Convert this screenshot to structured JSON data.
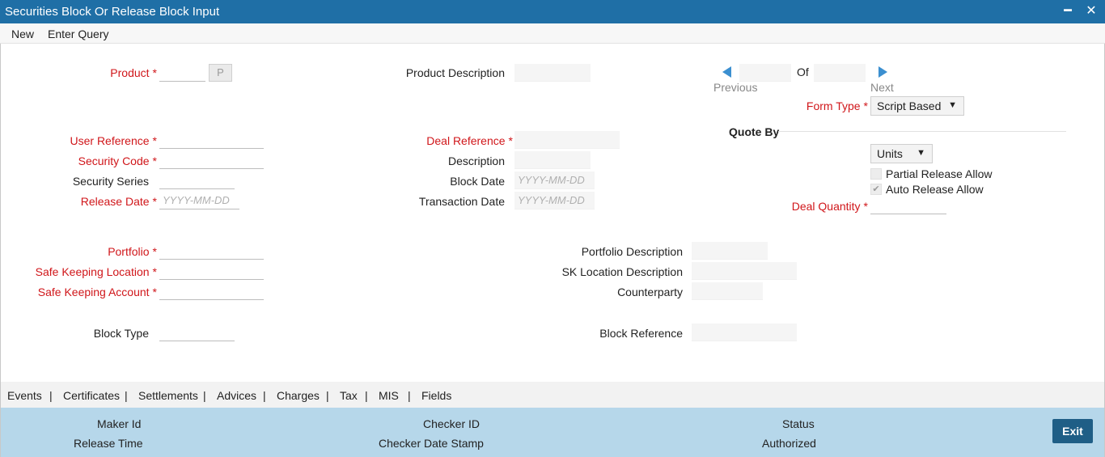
{
  "window": {
    "title": "Securities Block Or Release Block Input",
    "minimize_label": "━",
    "close_label": "✕"
  },
  "menu": {
    "new_label": "New",
    "enter_query_label": "Enter Query"
  },
  "form": {
    "product_label": "Product",
    "product_button_label": "P",
    "product_description_label": "Product Description",
    "nav_previous_label": "Previous",
    "nav_of_label": "Of",
    "nav_next_label": "Next",
    "form_type_label": "Form Type",
    "form_type_value": "Script Based",
    "quote_by_heading": "Quote By",
    "quote_by_value": "Units",
    "partial_release_label": "Partial Release Allow",
    "auto_release_label": "Auto Release Allow",
    "deal_quantity_label": "Deal Quantity",
    "user_reference_label": "User Reference",
    "security_code_label": "Security Code",
    "security_series_label": "Security Series",
    "release_date_label": "Release Date",
    "release_date_placeholder": "YYYY-MM-DD",
    "deal_reference_label": "Deal Reference",
    "description_label": "Description",
    "block_date_label": "Block Date",
    "block_date_placeholder": "YYYY-MM-DD",
    "transaction_date_label": "Transaction Date",
    "transaction_date_placeholder": "YYYY-MM-DD",
    "portfolio_label": "Portfolio",
    "safe_keeping_location_label": "Safe Keeping Location",
    "safe_keeping_account_label": "Safe Keeping Account",
    "portfolio_description_label": "Portfolio Description",
    "sk_location_description_label": "SK Location Description",
    "counterparty_label": "Counterparty",
    "block_type_label": "Block Type",
    "block_reference_label": "Block Reference",
    "required_marker": "*",
    "checkmark": "✔"
  },
  "tabs": {
    "events": "Events",
    "certificates": "Certificates",
    "settlements": "Settlements",
    "advices": "Advices",
    "charges": "Charges",
    "tax": "Tax",
    "mis": "MIS",
    "fields": "Fields",
    "separator": "|"
  },
  "footer": {
    "maker_id_label": "Maker Id",
    "release_time_label": "Release Time",
    "checker_id_label": "Checker ID",
    "checker_date_stamp_label": "Checker Date Stamp",
    "status_label": "Status",
    "authorized_label": "Authorized",
    "exit_label": "Exit"
  },
  "colors": {
    "titlebar": "#1f6fa6",
    "required": "#d0161a",
    "footer": "#b6d7ea",
    "exit_button": "#1f5e86",
    "nav_arrow": "#3b8fd0"
  }
}
